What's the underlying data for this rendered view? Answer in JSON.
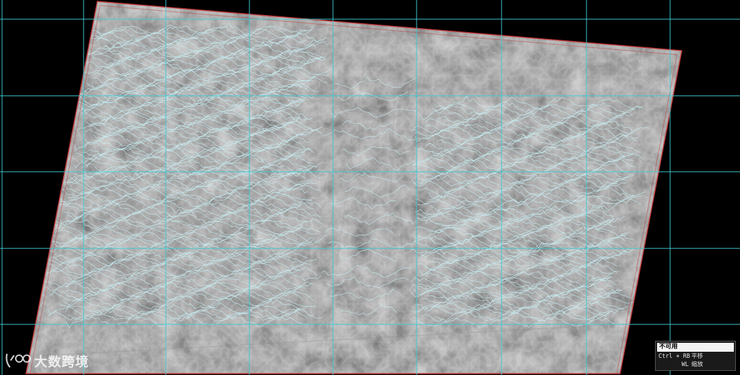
{
  "viewport": {
    "grid_color": "#3ec9d2",
    "footprint_color": "#c23a3a",
    "contour_color": "#c8eef5",
    "background_color": "#000000"
  },
  "status_panel": {
    "title": "不可用",
    "hints": [
      {
        "key": "Ctrl + RB",
        "action": "平移"
      },
      {
        "key": "WL",
        "action": "缩放"
      }
    ]
  },
  "watermark": {
    "logo_icon": "brand-logo-icon",
    "text": "大数跨境"
  }
}
